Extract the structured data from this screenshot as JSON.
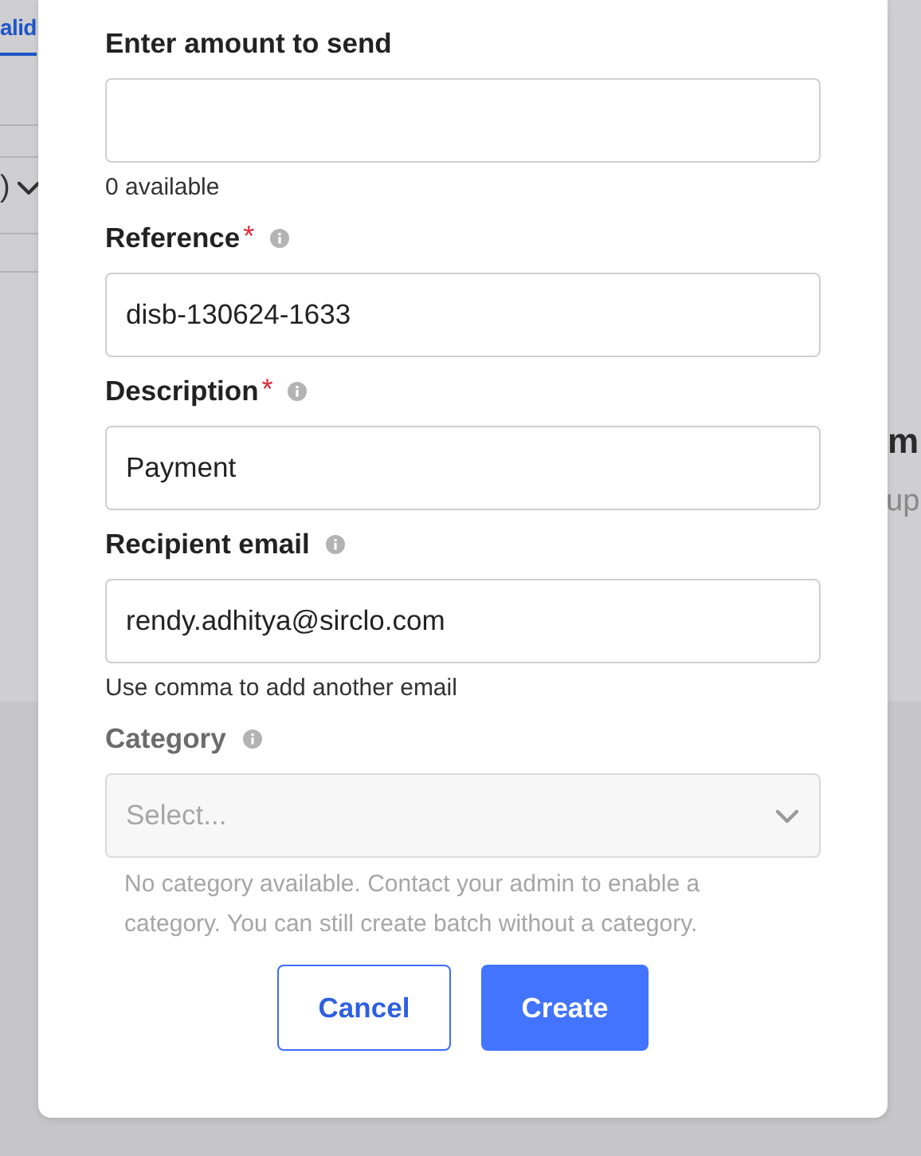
{
  "background": {
    "tab": "alid",
    "dropdown_value": ")",
    "heading": "m",
    "subheading": "up"
  },
  "form": {
    "fields": [
      {
        "kind": "text",
        "label": "Enter amount to send",
        "info": false,
        "hint": "0 available"
      },
      {
        "kind": "text",
        "label": "Reference",
        "required_mark": "*",
        "info": true,
        "value": "disb-130624-1633"
      },
      {
        "kind": "text",
        "label": "Description",
        "required_mark": "*",
        "info": true,
        "value": "Payment"
      },
      {
        "kind": "text",
        "label": "Recipient email",
        "info": true,
        "value": "rendy.adhitya@sirclo.com",
        "hint": "Use comma to add another email"
      },
      {
        "kind": "select",
        "label": "Category",
        "info": true,
        "disabled": true,
        "placeholder": "Select...",
        "hint": "No category available. Contact your admin to enable a category. You can still create batch without a category."
      }
    ],
    "buttons": [
      {
        "kind": "secondary",
        "label": "Cancel"
      },
      {
        "kind": "primary",
        "label": "Create"
      }
    ]
  }
}
